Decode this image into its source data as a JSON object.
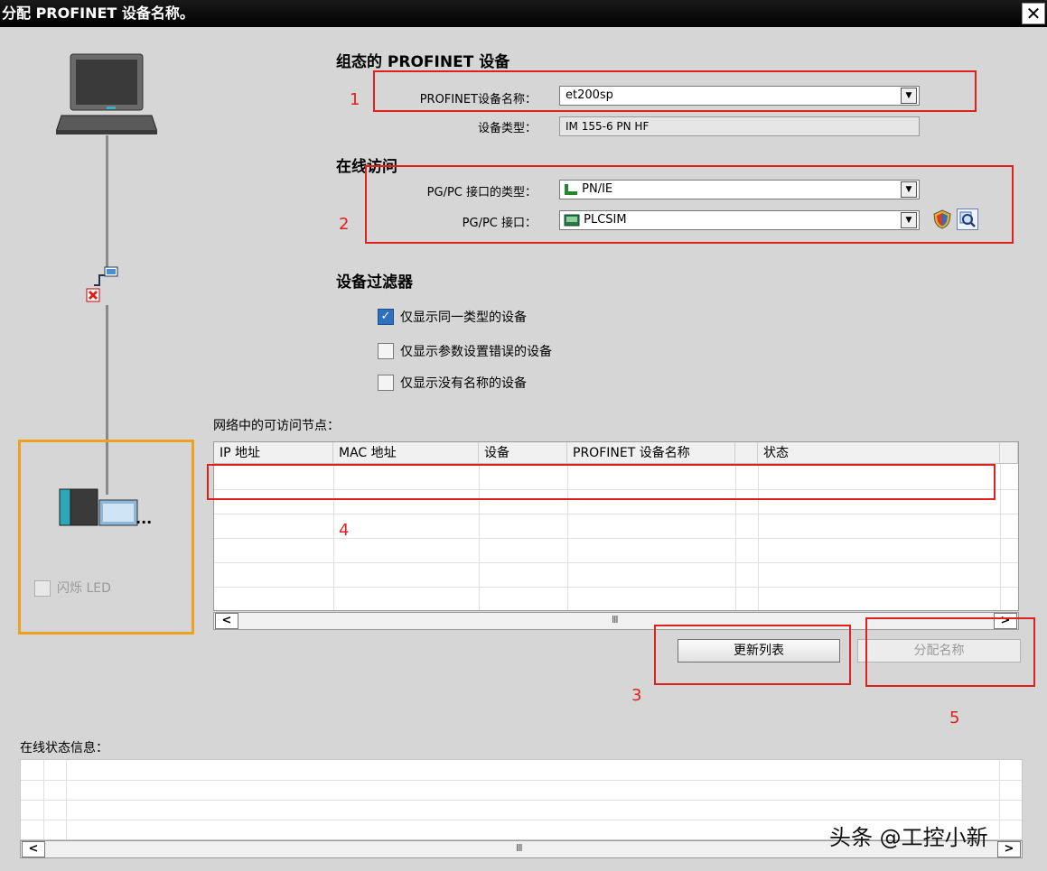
{
  "window": {
    "title": "分配 PROFINET 设备名称。",
    "close_glyph": "✕"
  },
  "configured_device": {
    "heading": "组态的 PROFINET 设备",
    "name_label": "PROFINET设备名称：",
    "name_value": "et200sp",
    "type_label": "设备类型：",
    "type_value": "IM 155-6 PN HF"
  },
  "online_access": {
    "heading": "在线访问",
    "interface_type_label": "PG/PC 接口的类型：",
    "interface_type_value": "PN/IE",
    "interface_label": "PG/PC 接口：",
    "interface_value": "PLCSIM"
  },
  "device_filter": {
    "heading": "设备过滤器",
    "options": [
      {
        "label": "仅显示同一类型的设备",
        "checked": true
      },
      {
        "label": "仅显示参数设置错误的设备",
        "checked": false
      },
      {
        "label": "仅显示没有名称的设备",
        "checked": false
      }
    ]
  },
  "nodes": {
    "heading": "网络中的可访问节点：",
    "columns": [
      "IP 地址",
      "MAC 地址",
      "设备",
      "PROFINET 设备名称",
      "状态"
    ]
  },
  "buttons": {
    "update_list": "更新列表",
    "assign_name": "分配名称"
  },
  "left_panel": {
    "flash_led": "闪烁 LED",
    "ellipsis": "..."
  },
  "status_info": {
    "heading": "在线状态信息："
  },
  "scroll": {
    "left": "<",
    "right": ">",
    "grip": "Ⅲ"
  },
  "annotations": [
    "1",
    "2",
    "3",
    "4",
    "5"
  ],
  "watermark": "头条 @工控小新",
  "icons": [
    "laptop-icon",
    "network-error-icon",
    "device-icon",
    "security-icon",
    "search-icon",
    "network-adapter-icon",
    "plcsim-icon"
  ],
  "colors": {
    "annotation_red": "#e0201c",
    "highlight_orange": "#f0a020",
    "checkbox_blue": "#2f6fc0"
  }
}
